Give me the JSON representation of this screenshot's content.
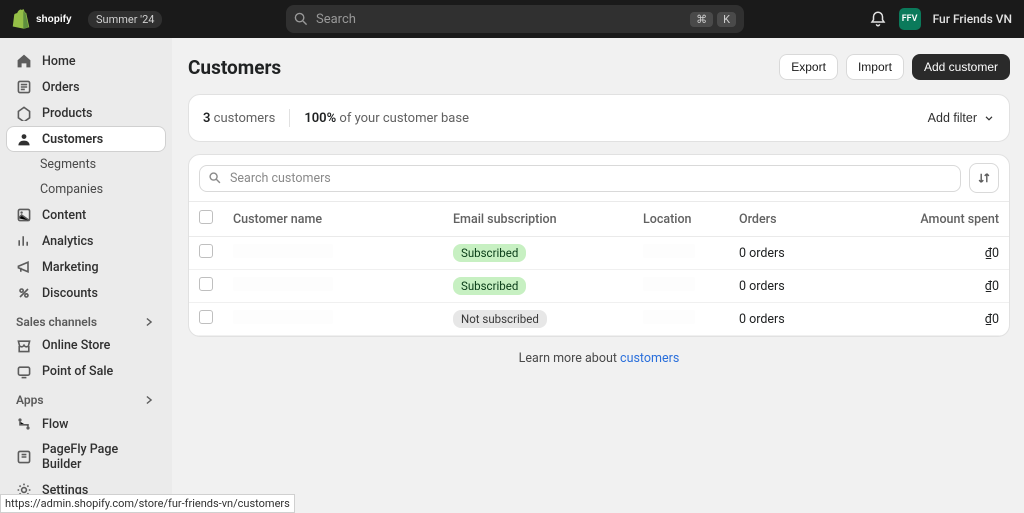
{
  "topbar": {
    "season_pill": "Summer '24",
    "search_placeholder": "Search",
    "kbd_mod": "⌘",
    "kbd_key": "K",
    "store_initials": "FFV",
    "store_name": "Fur Friends VN"
  },
  "sidebar": {
    "items": [
      {
        "id": "home",
        "label": "Home"
      },
      {
        "id": "orders",
        "label": "Orders"
      },
      {
        "id": "products",
        "label": "Products"
      },
      {
        "id": "customers",
        "label": "Customers"
      },
      {
        "id": "segments",
        "label": "Segments"
      },
      {
        "id": "companies",
        "label": "Companies"
      },
      {
        "id": "content",
        "label": "Content"
      },
      {
        "id": "analytics",
        "label": "Analytics"
      },
      {
        "id": "marketing",
        "label": "Marketing"
      },
      {
        "id": "discounts",
        "label": "Discounts"
      }
    ],
    "sales_channels_heading": "Sales channels",
    "sales_channels": [
      {
        "id": "online-store",
        "label": "Online Store"
      },
      {
        "id": "point-of-sale",
        "label": "Point of Sale"
      }
    ],
    "apps_heading": "Apps",
    "apps": [
      {
        "id": "flow",
        "label": "Flow"
      },
      {
        "id": "pagefly",
        "label": "PageFly Page Builder"
      }
    ],
    "settings_label": "Settings"
  },
  "page": {
    "title": "Customers",
    "export_label": "Export",
    "import_label": "Import",
    "add_customer_label": "Add customer",
    "summary_count_number": "3",
    "summary_count_word": "customers",
    "summary_pct": "100%",
    "summary_pct_rest": "of your customer base",
    "filter_label": "Add filter",
    "search_placeholder": "Search customers",
    "learn_prefix": "Learn more about ",
    "learn_link": "customers"
  },
  "table": {
    "columns": {
      "name": "Customer name",
      "email": "Email subscription",
      "location": "Location",
      "orders": "Orders",
      "amount": "Amount spent"
    },
    "rows": [
      {
        "subscription_status": "Subscribed",
        "subscription_kind": "sub",
        "orders": "0 orders",
        "amount": "₫0"
      },
      {
        "subscription_status": "Subscribed",
        "subscription_kind": "sub",
        "orders": "0 orders",
        "amount": "₫0"
      },
      {
        "subscription_status": "Not subscribed",
        "subscription_kind": "nosub",
        "orders": "0 orders",
        "amount": "₫0"
      }
    ]
  },
  "status_url": "https://admin.shopify.com/store/fur-friends-vn/customers"
}
